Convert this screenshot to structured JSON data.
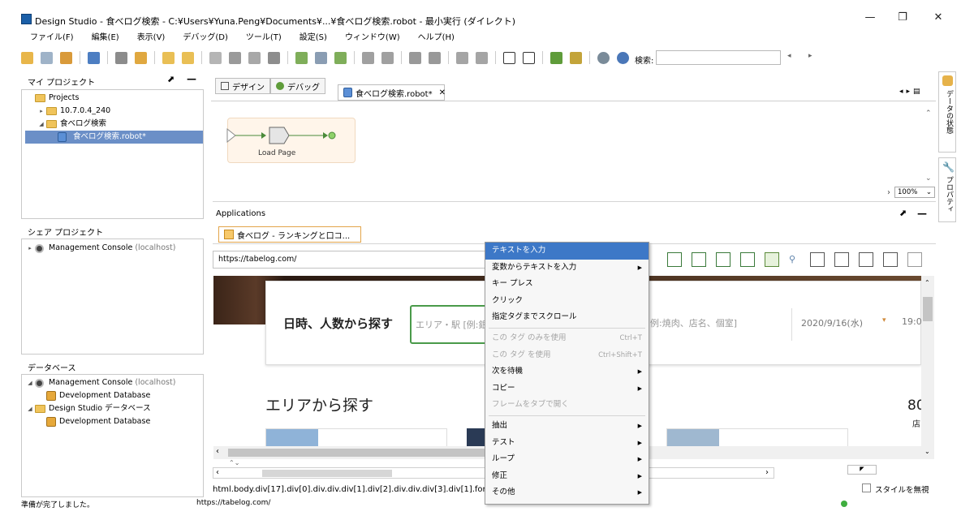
{
  "window": {
    "title": "Design Studio - 食べログ検索 - C:¥Users¥Yuna.Peng¥Documents¥...¥食べログ検索.robot - 最小実行 (ダイレクト)",
    "minimize": "—",
    "restore": "❐",
    "close": "✕"
  },
  "menubar": [
    "ファイル(F)",
    "編集(E)",
    "表示(V)",
    "デバッグ(D)",
    "ツール(T)",
    "設定(S)",
    "ウィンドウ(W)",
    "ヘルプ(H)"
  ],
  "toolbar": {
    "search_label": "検索:",
    "search_value": "",
    "prev": "◂",
    "next": "▸"
  },
  "my_project": {
    "title": "マイ プロジェクト",
    "items": [
      {
        "label": "Projects",
        "level": 0,
        "icon": "folder-icon",
        "expander": ""
      },
      {
        "label": "10.7.0.4_240",
        "level": 1,
        "icon": "folder-icon",
        "expander": "▸"
      },
      {
        "label": "食べログ検索",
        "level": 1,
        "icon": "folder-icon",
        "expander": "◢"
      },
      {
        "label": "食べログ検索.robot*",
        "level": 2,
        "icon": "robot-icon",
        "expander": "",
        "selected": true
      }
    ]
  },
  "shared_project": {
    "title": "シェア プロジェクト",
    "items": [
      {
        "label": "Management Console",
        "suffix": "(localhost)"
      }
    ]
  },
  "database": {
    "title": "データベース",
    "items": [
      {
        "label": "Management Console",
        "suffix": "(localhost)",
        "level": 0,
        "icon": "console-icon",
        "expander": "◢"
      },
      {
        "label": "Development Database",
        "suffix": "",
        "level": 1,
        "icon": "db-icon",
        "expander": ""
      },
      {
        "label": "Design Studio データベース",
        "suffix": "",
        "level": 0,
        "icon": "folder-icon",
        "expander": "◢"
      },
      {
        "label": "Development Database",
        "suffix": "",
        "level": 1,
        "icon": "db-icon",
        "expander": ""
      }
    ]
  },
  "editor": {
    "design_tab": "デザイン",
    "debug_tab": "デバッグ",
    "file_tab": "食べログ検索.robot*",
    "file_tab_close": "✕",
    "step_label": "Load Page",
    "zoom": "100%"
  },
  "applications": {
    "title": "Applications",
    "tab_label": "食べログ - ランキングと口コ...",
    "url": "https://tabelog.com/",
    "dom_path": "html.body.div[17].div[0].div.div.div[1].div[2].div.div.div[3].div[1].form.",
    "ignore_style": "スタイルを無視"
  },
  "webpage": {
    "search_heading": "日時、人数から探す",
    "area_placeholder": "エリア・駅 [例:銀",
    "keyword_placeholder": "例:焼肉、店名、個室]",
    "date": "2020/9/16(水)",
    "time": "19:0",
    "area_heading": "エリアから探す",
    "count": "80",
    "count_unit": "店"
  },
  "context_menu": {
    "items": [
      {
        "label": "テキストを入力",
        "selected": true
      },
      {
        "label": "変数からテキストを入力",
        "submenu": true
      },
      {
        "label": "キー プレス"
      },
      {
        "label": "クリック"
      },
      {
        "label": "指定タグまでスクロール"
      },
      {
        "sep": true
      },
      {
        "label": "この タグ のみを使用",
        "shortcut": "Ctrl+T",
        "disabled": true
      },
      {
        "label": "この タグ を使用",
        "shortcut": "Ctrl+Shift+T",
        "disabled": true
      },
      {
        "label": "次を待機",
        "submenu": true
      },
      {
        "label": "コピー",
        "submenu": true
      },
      {
        "label": "フレームをタブで開く",
        "disabled": true
      },
      {
        "sep": true
      },
      {
        "label": "抽出",
        "submenu": true
      },
      {
        "label": "テスト",
        "submenu": true
      },
      {
        "label": "ループ",
        "submenu": true
      },
      {
        "label": "修正",
        "submenu": true
      },
      {
        "label": "その他",
        "submenu": true
      }
    ]
  },
  "right_tabs": {
    "data_state": "データの状態",
    "properties": "プロパティ"
  },
  "status": {
    "message": "準備が完了しました。",
    "url": "https://tabelog.com/"
  }
}
